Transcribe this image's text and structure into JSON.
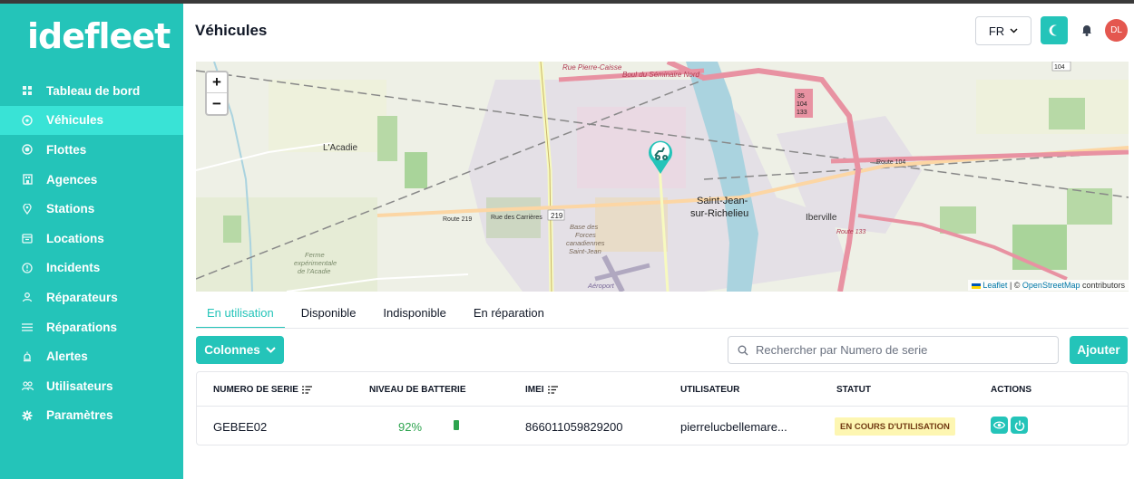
{
  "app": {
    "logo": "idefleet",
    "page_title": "Véhicules",
    "language": "FR",
    "avatar_initials": "DL",
    "accent_color": "#24c4b9"
  },
  "sidebar": {
    "items": [
      {
        "label": "Tableau de bord",
        "icon": "dashboard-icon"
      },
      {
        "label": "Véhicules",
        "icon": "vehicle-icon",
        "active": true
      },
      {
        "label": "Flottes",
        "icon": "fleet-icon"
      },
      {
        "label": "Agences",
        "icon": "building-icon"
      },
      {
        "label": "Stations",
        "icon": "location-pin-icon"
      },
      {
        "label": "Locations",
        "icon": "calendar-icon"
      },
      {
        "label": "Incidents",
        "icon": "alert-circle-icon"
      },
      {
        "label": "Réparateurs",
        "icon": "user-icon"
      },
      {
        "label": "Réparations",
        "icon": "list-icon"
      },
      {
        "label": "Alertes",
        "icon": "alarm-icon"
      },
      {
        "label": "Utilisateurs",
        "icon": "users-icon"
      },
      {
        "label": "Paramètres",
        "icon": "gear-icon"
      }
    ]
  },
  "map": {
    "zoom_in": "+",
    "zoom_out": "−",
    "labels": [
      "L'Acadie",
      "Saint-Jean-sur-Richelieu",
      "Iberville",
      "Rue Pierre-Caisse",
      "Boul du Séminaire Nord",
      "Route 104",
      "Route 219",
      "Rue des Carrières",
      "Route 133",
      "Base des Forces canadiennes Saint-Jean",
      "Ferme expérimentale de l'Acadie",
      "Aéroport"
    ],
    "attribution_leaflet": "Leaflet",
    "attribution_sep": " | © ",
    "attribution_osm": "OpenStreetMap",
    "attribution_suffix": " contributors"
  },
  "tabs": [
    "En utilisation",
    "Disponible",
    "Indisponible",
    "En réparation"
  ],
  "toolbar": {
    "columns_label": "Colonnes",
    "search_placeholder": "Rechercher par Numero de serie",
    "add_label": "Ajouter"
  },
  "table": {
    "headers": [
      "NUMERO DE SERIE",
      "NIVEAU DE BATTERIE",
      "IMEI",
      "UTILISATEUR",
      "STATUT",
      "ACTIONS"
    ],
    "rows": [
      {
        "serial": "GEBEE02",
        "battery": "92%",
        "imei": "866011059829200",
        "user": "pierrelucbellemare...",
        "status": "EN COURS D'UTILISATION",
        "status_bg": "#fdf6b2",
        "status_color": "#723b13"
      }
    ]
  }
}
